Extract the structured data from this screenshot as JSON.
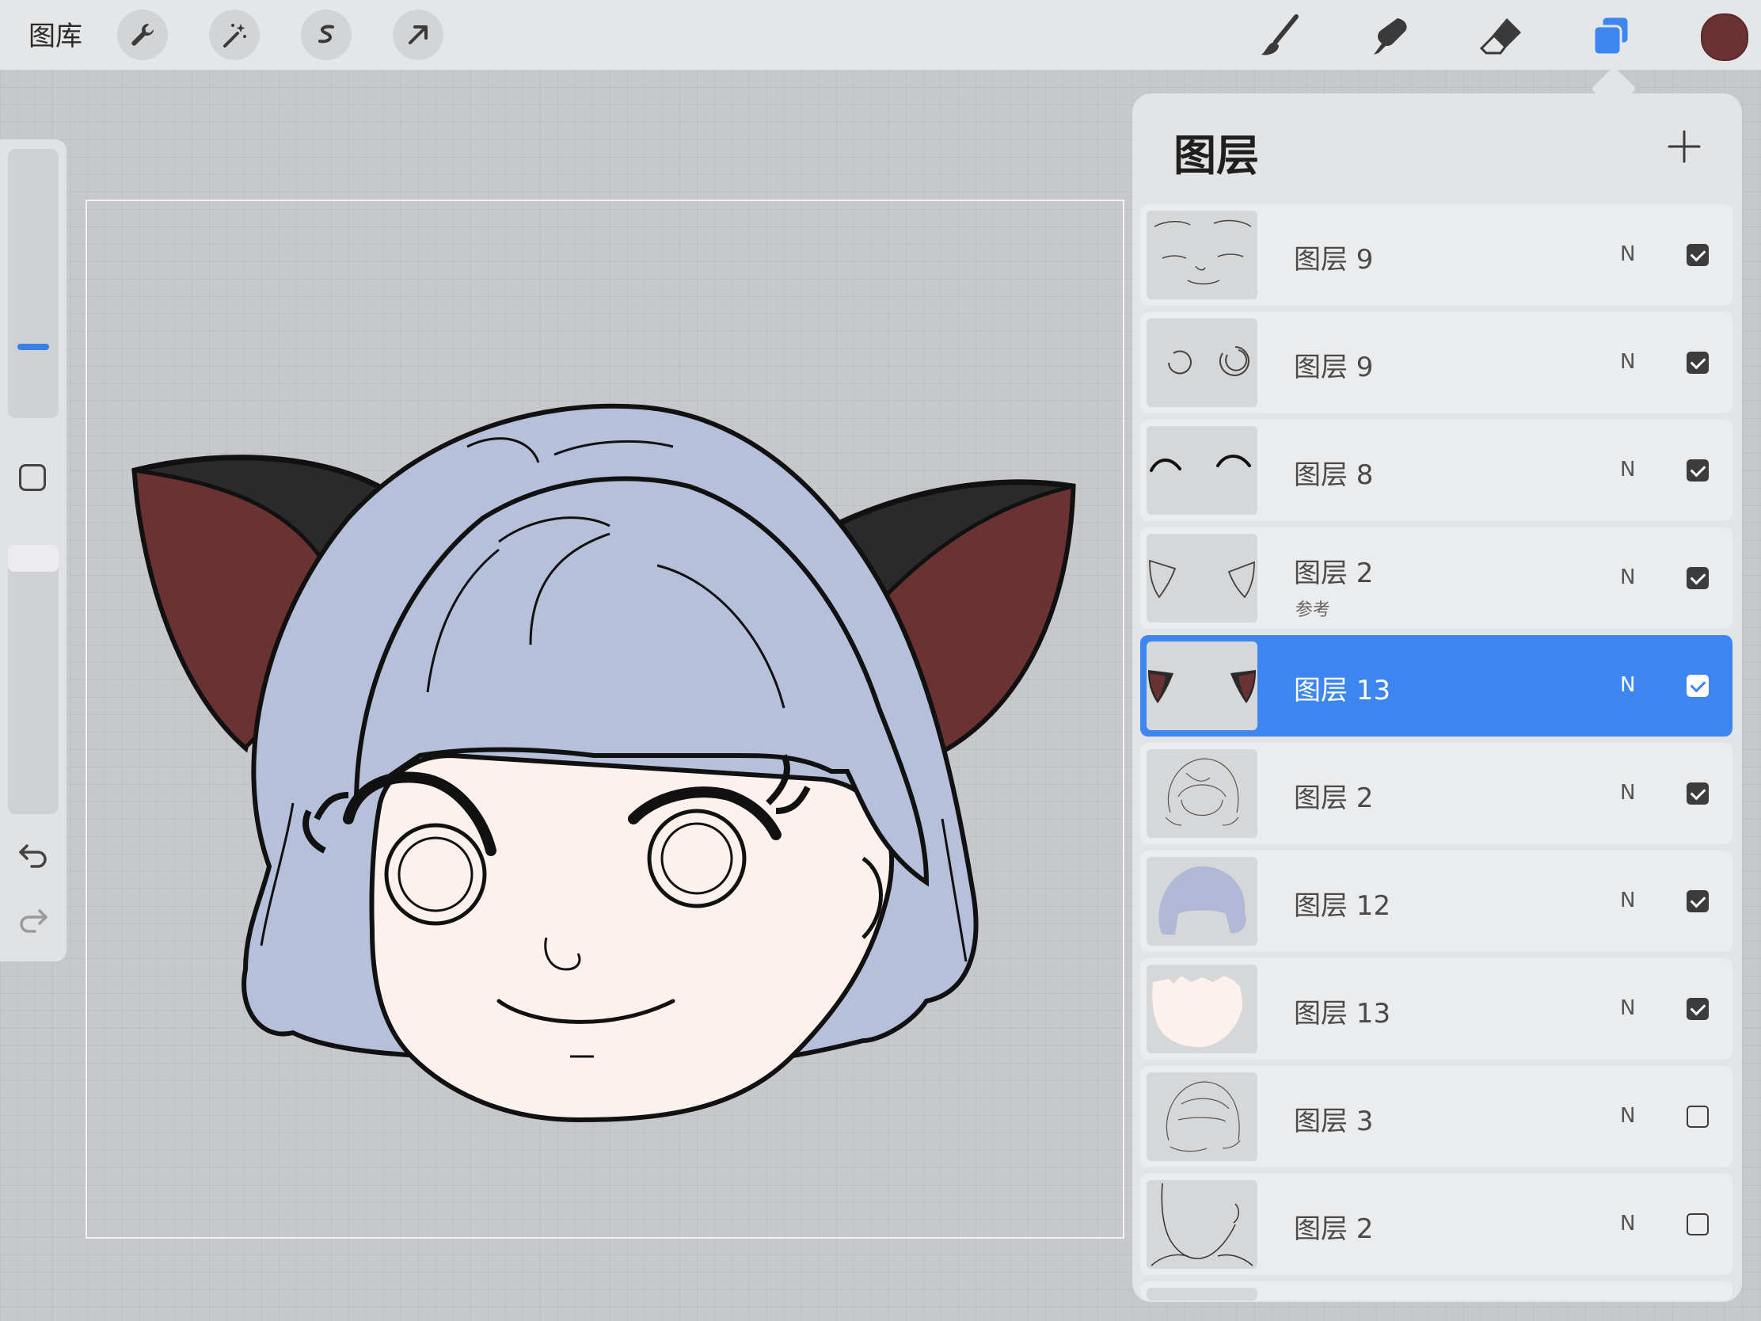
{
  "topbar": {
    "gallery_label": "图库",
    "left_tools": [
      "wrench-icon",
      "magic-wand-icon",
      "selection-icon",
      "move-arrow-icon"
    ],
    "right_tools": [
      "brush-icon",
      "smudge-icon",
      "eraser-icon",
      "layers-icon"
    ],
    "current_color": "#6b3232",
    "accent": "#3d85f0"
  },
  "panel": {
    "title": "图层",
    "add_icon": "plus-icon",
    "layers": [
      {
        "name": "图层 9",
        "blend": "N",
        "visible": true,
        "selected": false,
        "sub": ""
      },
      {
        "name": "图层 9",
        "blend": "N",
        "visible": true,
        "selected": false,
        "sub": ""
      },
      {
        "name": "图层 8",
        "blend": "N",
        "visible": true,
        "selected": false,
        "sub": ""
      },
      {
        "name": "图层 2",
        "blend": "N",
        "visible": true,
        "selected": false,
        "sub": "参考"
      },
      {
        "name": "图层 13",
        "blend": "N",
        "visible": true,
        "selected": true,
        "sub": ""
      },
      {
        "name": "图层 2",
        "blend": "N",
        "visible": true,
        "selected": false,
        "sub": ""
      },
      {
        "name": "图层 12",
        "blend": "N",
        "visible": true,
        "selected": false,
        "sub": ""
      },
      {
        "name": "图层 13",
        "blend": "N",
        "visible": true,
        "selected": false,
        "sub": ""
      },
      {
        "name": "图层 3",
        "blend": "N",
        "visible": false,
        "selected": false,
        "sub": ""
      },
      {
        "name": "图层 2",
        "blend": "N",
        "visible": false,
        "selected": false,
        "sub": ""
      }
    ]
  }
}
